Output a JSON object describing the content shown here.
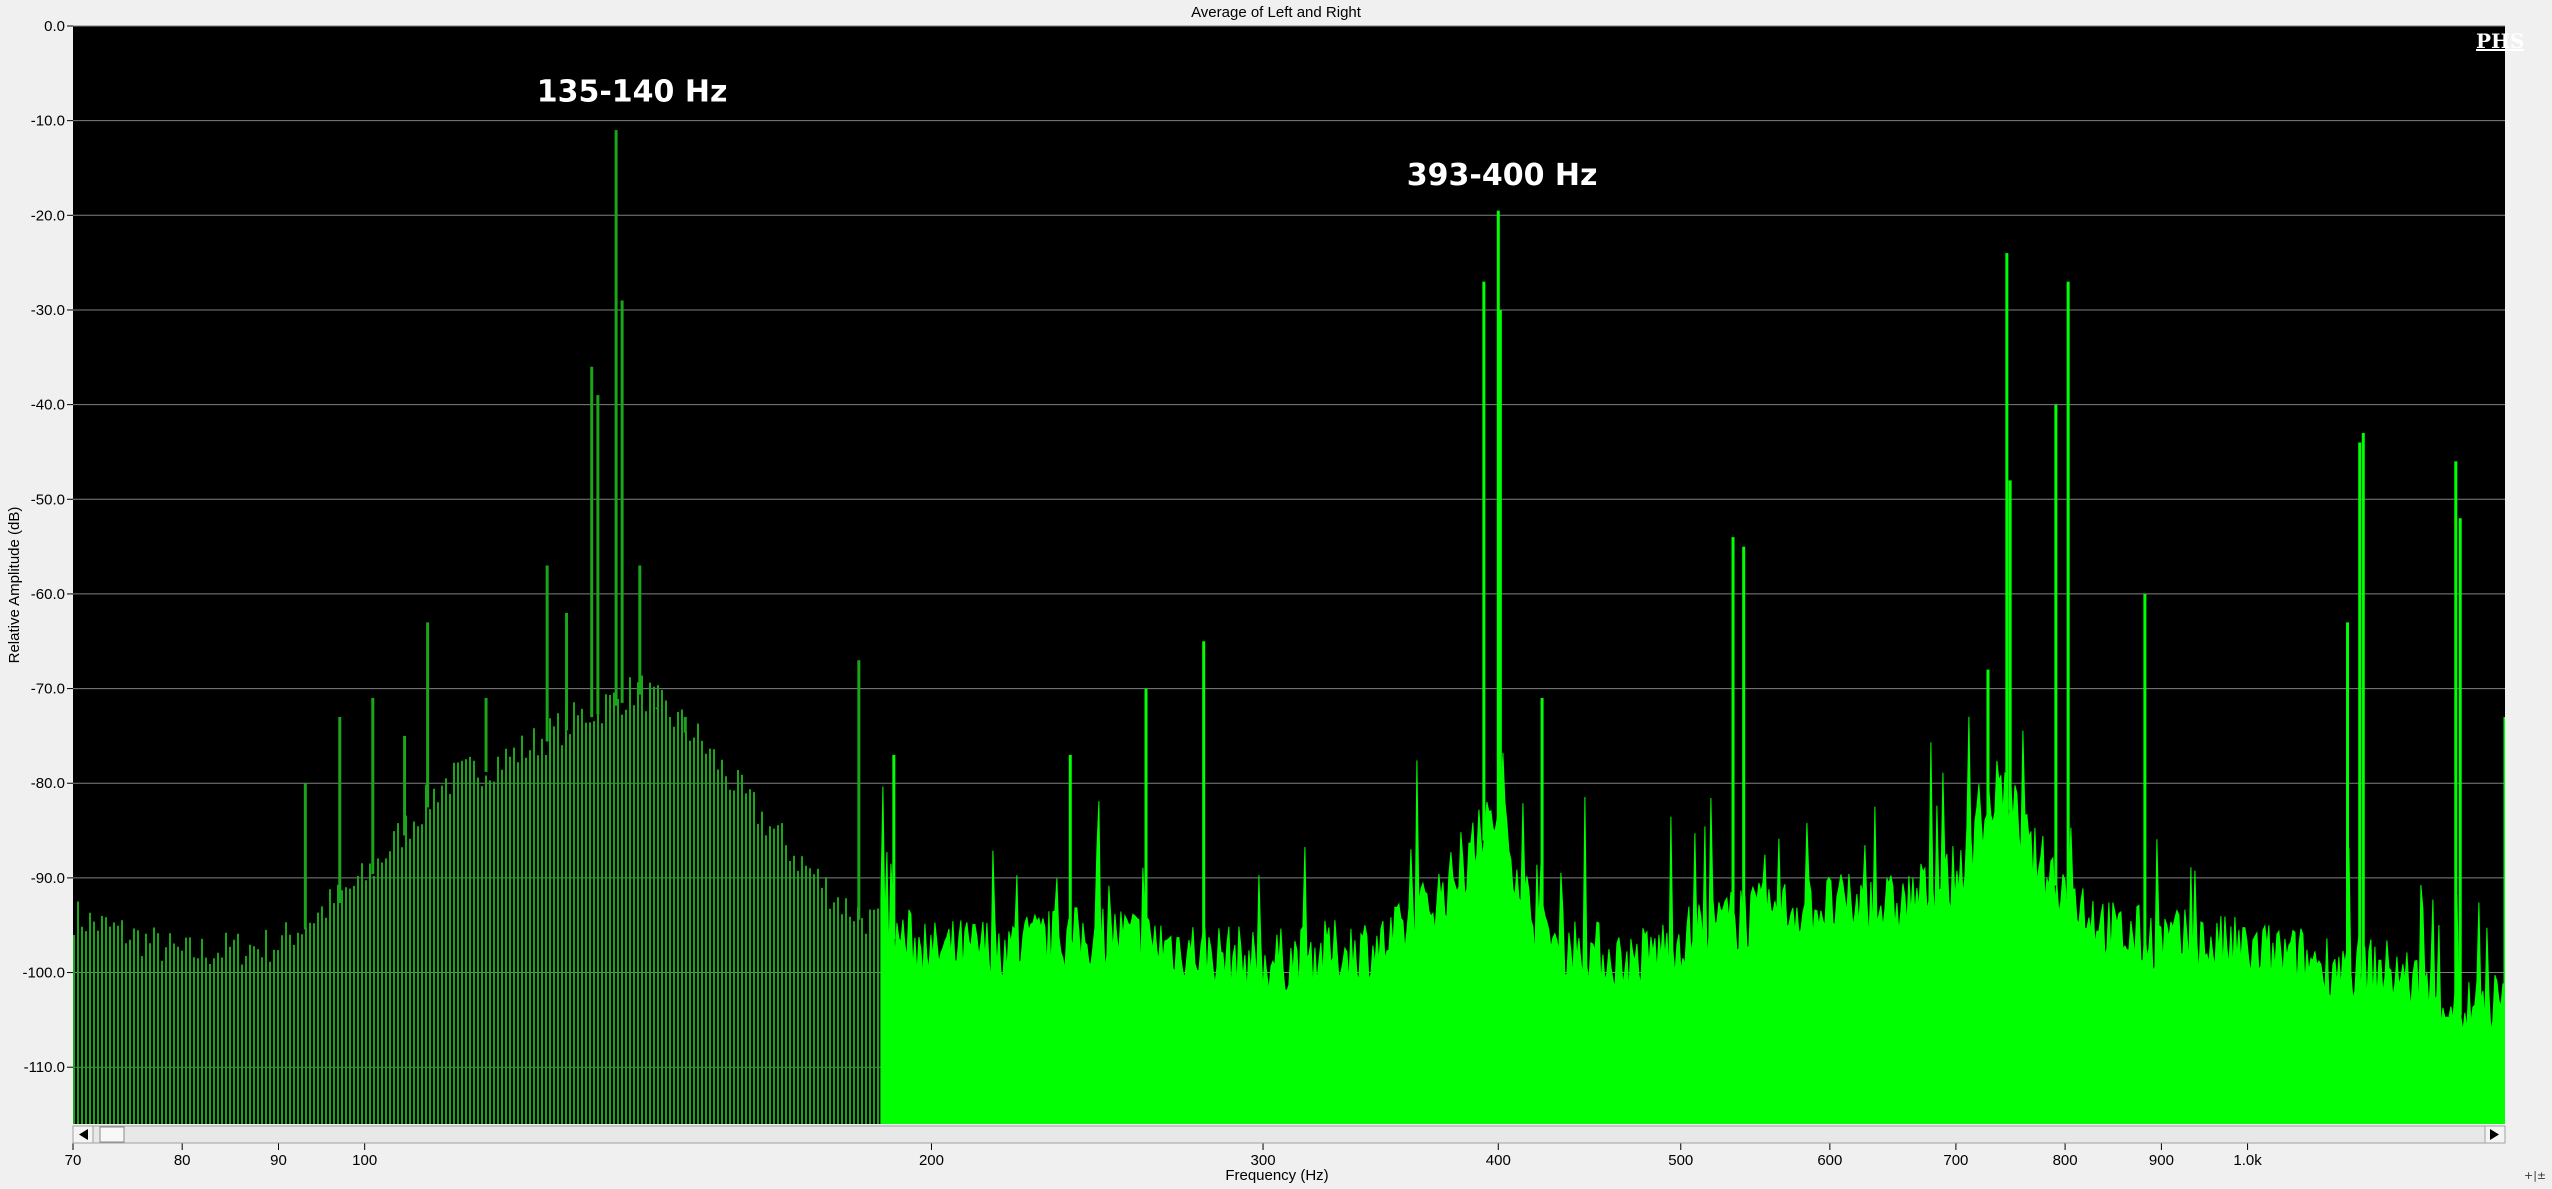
{
  "window": {
    "title": "Average of Left and Right",
    "watermark": "PHS"
  },
  "colors": {
    "plot_background": "#000000",
    "spectrum_fill": "#00ff00",
    "spectrum_dark": "#1aa51a",
    "gridline": "#7f7f7f",
    "frame": "#f0f0f0"
  },
  "chart_data": {
    "type": "area",
    "title": "Average of Left and Right",
    "xlabel": "Frequency (Hz)",
    "ylabel": "Relative Amplitude (dB)",
    "x_scale": "log",
    "xlim": [
      70,
      1370
    ],
    "ylim": [
      -116,
      0
    ],
    "grid": true,
    "x_ticks": [
      {
        "value": 70,
        "label": "70"
      },
      {
        "value": 80,
        "label": "80"
      },
      {
        "value": 90,
        "label": "90"
      },
      {
        "value": 100,
        "label": "100"
      },
      {
        "value": 200,
        "label": "200"
      },
      {
        "value": 300,
        "label": "300"
      },
      {
        "value": 400,
        "label": "400"
      },
      {
        "value": 500,
        "label": "500"
      },
      {
        "value": 600,
        "label": "600"
      },
      {
        "value": 700,
        "label": "700"
      },
      {
        "value": 800,
        "label": "800"
      },
      {
        "value": 900,
        "label": "900"
      },
      {
        "value": 1000,
        "label": "1.0k"
      }
    ],
    "y_ticks": [
      {
        "value": 0,
        "label": "0.0"
      },
      {
        "value": -10,
        "label": "-10.0"
      },
      {
        "value": -20,
        "label": "-20.0"
      },
      {
        "value": -30,
        "label": "-30.0"
      },
      {
        "value": -40,
        "label": "-40.0"
      },
      {
        "value": -50,
        "label": "-50.0"
      },
      {
        "value": -60,
        "label": "-60.0"
      },
      {
        "value": -70,
        "label": "-70.0"
      },
      {
        "value": -80,
        "label": "-80.0"
      },
      {
        "value": -90,
        "label": "-90.0"
      },
      {
        "value": -100,
        "label": "-100.0"
      },
      {
        "value": -110,
        "label": "-110.0"
      }
    ],
    "noise_floor": [
      {
        "x": 70,
        "y": -94
      },
      {
        "x": 75,
        "y": -96
      },
      {
        "x": 80,
        "y": -98
      },
      {
        "x": 90,
        "y": -97
      },
      {
        "x": 100,
        "y": -90
      },
      {
        "x": 110,
        "y": -80
      },
      {
        "x": 120,
        "y": -77
      },
      {
        "x": 130,
        "y": -73
      },
      {
        "x": 140,
        "y": -70
      },
      {
        "x": 150,
        "y": -75
      },
      {
        "x": 160,
        "y": -82
      },
      {
        "x": 170,
        "y": -88
      },
      {
        "x": 180,
        "y": -93
      },
      {
        "x": 200,
        "y": -98
      },
      {
        "x": 250,
        "y": -96
      },
      {
        "x": 300,
        "y": -99
      },
      {
        "x": 350,
        "y": -97
      },
      {
        "x": 380,
        "y": -90
      },
      {
        "x": 400,
        "y": -83
      },
      {
        "x": 420,
        "y": -96
      },
      {
        "x": 470,
        "y": -99
      },
      {
        "x": 520,
        "y": -95
      },
      {
        "x": 580,
        "y": -93
      },
      {
        "x": 650,
        "y": -93
      },
      {
        "x": 700,
        "y": -90
      },
      {
        "x": 740,
        "y": -80
      },
      {
        "x": 770,
        "y": -88
      },
      {
        "x": 850,
        "y": -96
      },
      {
        "x": 950,
        "y": -97
      },
      {
        "x": 1100,
        "y": -99
      },
      {
        "x": 1200,
        "y": -100
      },
      {
        "x": 1300,
        "y": -104
      },
      {
        "x": 1370,
        "y": -103
      }
    ],
    "peaks": [
      {
        "x": 93,
        "y": -80
      },
      {
        "x": 97,
        "y": -73
      },
      {
        "x": 101,
        "y": -71
      },
      {
        "x": 105,
        "y": -75
      },
      {
        "x": 108,
        "y": -63
      },
      {
        "x": 116,
        "y": -71
      },
      {
        "x": 125,
        "y": -57
      },
      {
        "x": 128,
        "y": -62
      },
      {
        "x": 132,
        "y": -36
      },
      {
        "x": 133,
        "y": -39
      },
      {
        "x": 136,
        "y": -11
      },
      {
        "x": 137,
        "y": -29
      },
      {
        "x": 140,
        "y": -57
      },
      {
        "x": 143,
        "y": -72
      },
      {
        "x": 148,
        "y": -73
      },
      {
        "x": 183,
        "y": -67
      },
      {
        "x": 191,
        "y": -77
      },
      {
        "x": 237,
        "y": -77
      },
      {
        "x": 260,
        "y": -70
      },
      {
        "x": 279,
        "y": -65
      },
      {
        "x": 393,
        "y": -27
      },
      {
        "x": 400,
        "y": -19.5
      },
      {
        "x": 401,
        "y": -30
      },
      {
        "x": 422,
        "y": -71
      },
      {
        "x": 533,
        "y": -54
      },
      {
        "x": 540,
        "y": -55
      },
      {
        "x": 728,
        "y": -68
      },
      {
        "x": 745,
        "y": -24
      },
      {
        "x": 748,
        "y": -48
      },
      {
        "x": 791,
        "y": -40
      },
      {
        "x": 803,
        "y": -27
      },
      {
        "x": 882,
        "y": -60
      },
      {
        "x": 1130,
        "y": -63
      },
      {
        "x": 1147,
        "y": -44
      },
      {
        "x": 1152,
        "y": -43
      },
      {
        "x": 1290,
        "y": -46
      },
      {
        "x": 1297,
        "y": -52
      },
      {
        "x": 1370,
        "y": -73
      }
    ],
    "annotations": [
      {
        "text": "135-140 Hz",
        "x": 137,
        "y": -8
      },
      {
        "text": "393-400 Hz",
        "x": 397,
        "y": -16.8
      }
    ]
  }
}
